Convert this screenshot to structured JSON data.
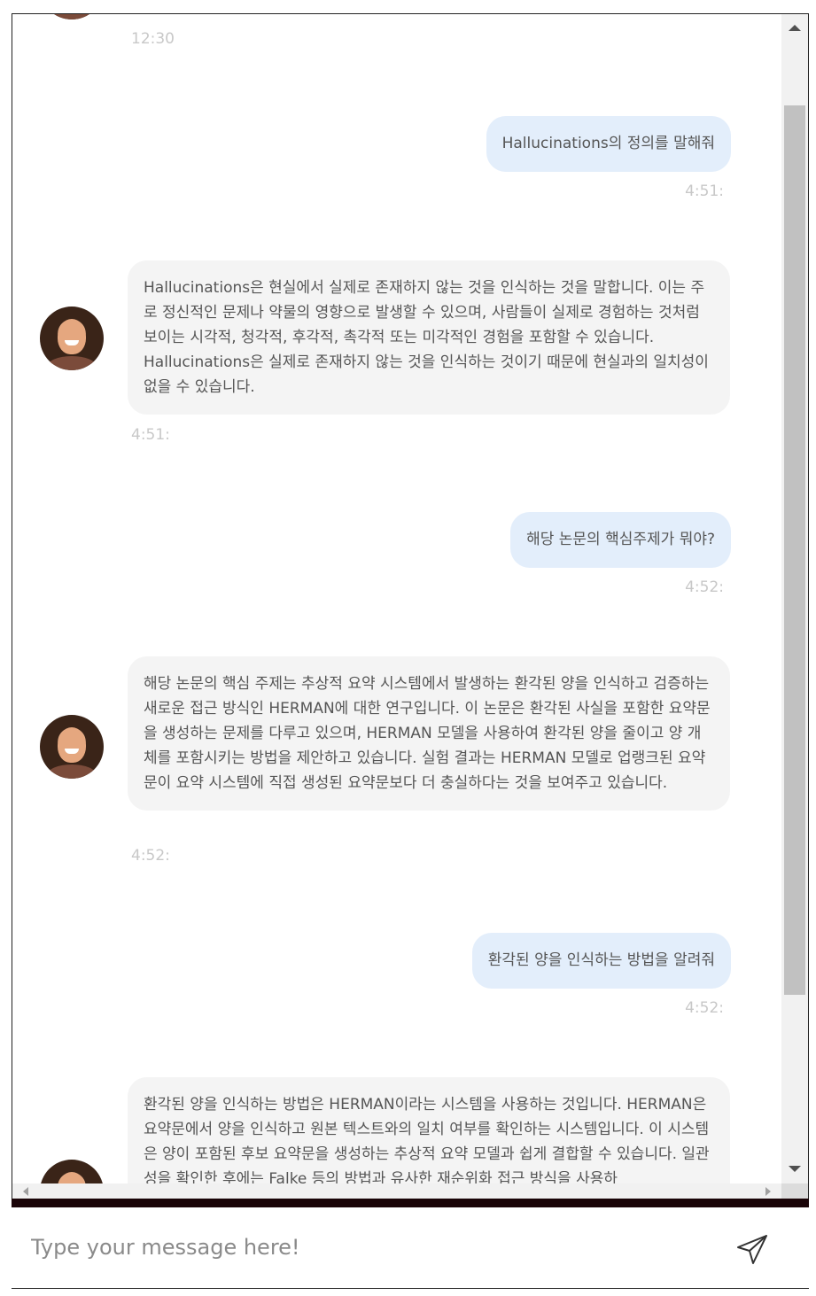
{
  "messages": [
    {
      "role": "bot",
      "time": "12:30"
    },
    {
      "role": "user",
      "text": "Hallucinations의 정의를 말해줘",
      "time": "4:51:"
    },
    {
      "role": "bot",
      "text": "Hallucinations은 현실에서 실제로 존재하지 않는 것을 인식하는 것을 말합니다. 이는 주로 정신적인 문제나 약물의 영향으로 발생할 수 있으며, 사람들이 실제로 경험하는 것처럼 보이는 시각적, 청각적, 후각적, 촉각적 또는 미각적인 경험을 포함할 수 있습니다. Hallucinations은 실제로 존재하지 않는 것을 인식하는 것이기 때문에 현실과의 일치성이 없을 수 있습니다.",
      "time": "4:51:"
    },
    {
      "role": "user",
      "text": "해당 논문의 핵심주제가 뭐야?",
      "time": "4:52:"
    },
    {
      "role": "bot",
      "text": "해당 논문의 핵심 주제는 추상적 요약 시스템에서 발생하는 환각된 양을 인식하고 검증하는 새로운 접근 방식인 HERMAN에 대한 연구입니다. 이 논문은 환각된 사실을 포함한 요약문을 생성하는 문제를 다루고 있으며, HERMAN 모델을 사용하여 환각된 양을 줄이고 양 개체를 포함시키는 방법을 제안하고 있습니다. 실험 결과는 HERMAN 모델로 업랭크된 요약문이 요약 시스템에 직접 생성된 요약문보다 더 충실하다는 것을 보여주고 있습니다.",
      "time": "4:52:"
    },
    {
      "role": "user",
      "text": "환각된 양을 인식하는 방법을 알려줘",
      "time": "4:52:"
    },
    {
      "role": "bot",
      "text": "환각된 양을 인식하는 방법은 HERMAN이라는 시스템을 사용하는 것입니다. HERMAN은 요약문에서 양을 인식하고 원본 텍스트와의 일치 여부를 확인하는 시스템입니다. 이 시스템은 양이 포함된 후보 요약문을 생성하는 추상적 요약 모델과 쉽게 결합할 수 있습니다. 일관성을 확인한 후에는 Falke 등의 방법과 유사한 재순위화 접근 방식을 사용하"
    }
  ],
  "input": {
    "placeholder": "Type your message here!",
    "value": ""
  },
  "icons": {
    "send": "send-paper-plane-icon",
    "avatar": "assistant-avatar"
  }
}
